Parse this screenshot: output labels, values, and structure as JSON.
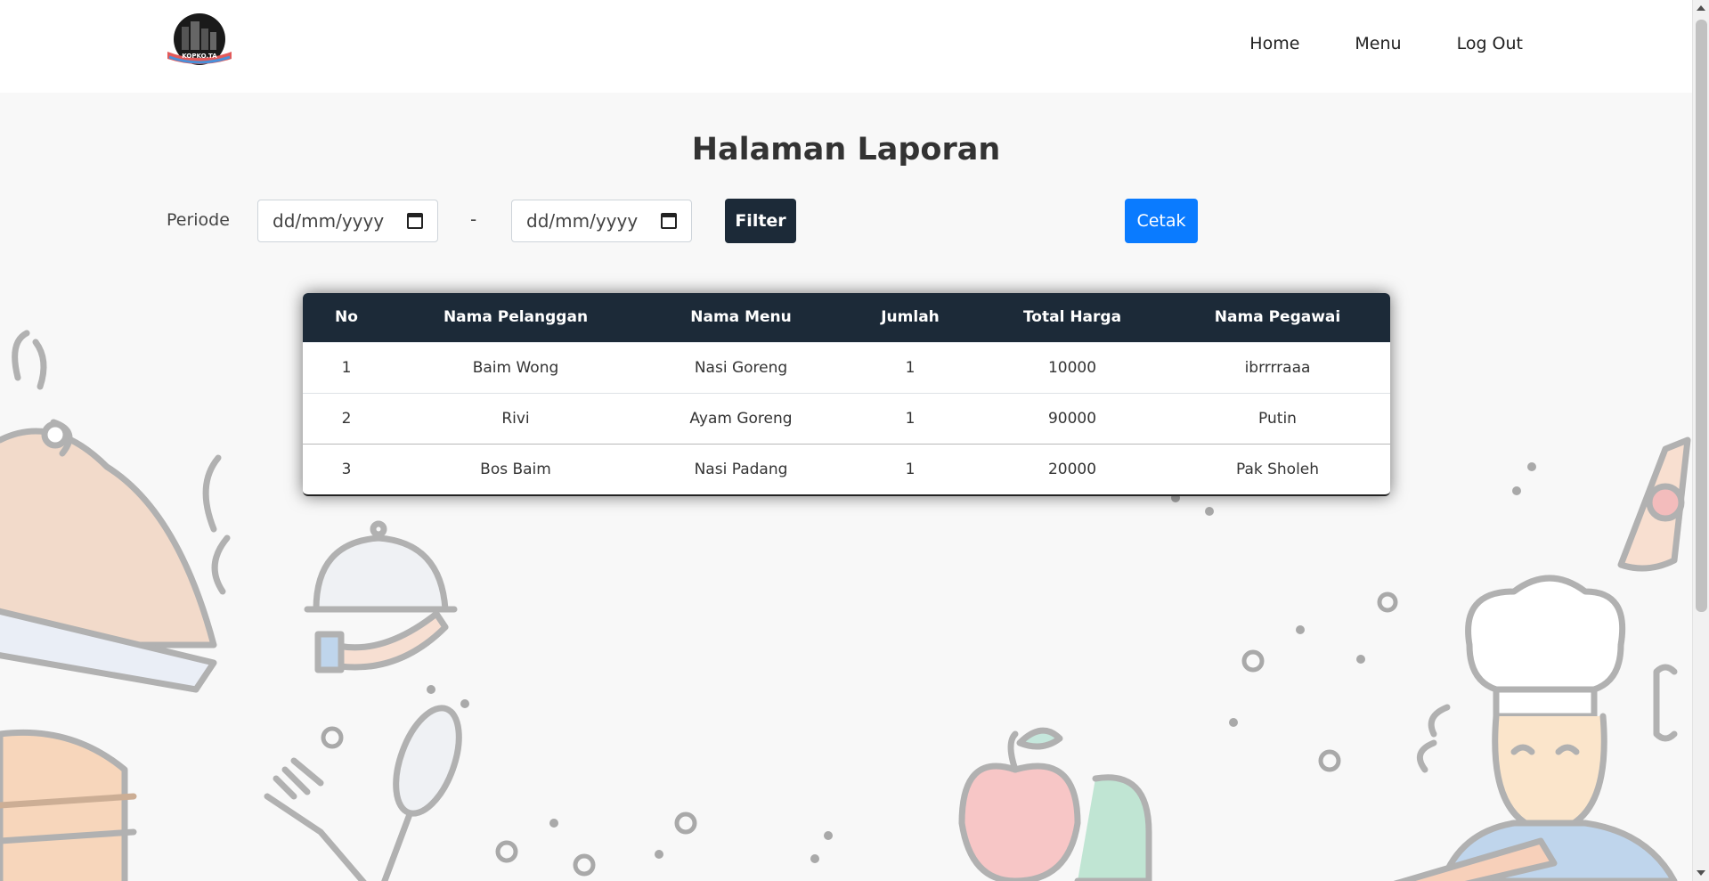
{
  "nav": {
    "logo_text": "KOPKO.TA",
    "links": [
      "Home",
      "Menu",
      "Log Out"
    ]
  },
  "page": {
    "title": "Halaman Laporan"
  },
  "filter": {
    "label": "Periode",
    "start_placeholder": "dd/mm/yyyy",
    "end_placeholder": "dd/mm/yyyy",
    "separator": "-",
    "filter_button": "Filter",
    "print_button": "Cetak"
  },
  "table": {
    "headers": [
      "No",
      "Nama Pelanggan",
      "Nama Menu",
      "Jumlah",
      "Total Harga",
      "Nama Pegawai"
    ],
    "rows": [
      [
        "1",
        "Baim Wong",
        "Nasi Goreng",
        "1",
        "10000",
        "ibrrrraaa"
      ],
      [
        "2",
        "Rivi",
        "Ayam Goreng",
        "1",
        "90000",
        "Putin"
      ],
      [
        "3",
        "Bos Baim",
        "Nasi Padang",
        "1",
        "20000",
        "Pak Sholeh"
      ]
    ]
  },
  "colors": {
    "navbar_bg": "#ffffff",
    "page_bg": "#f8f8f8",
    "dark": "#1c2a38",
    "primary": "#0a7bff"
  }
}
